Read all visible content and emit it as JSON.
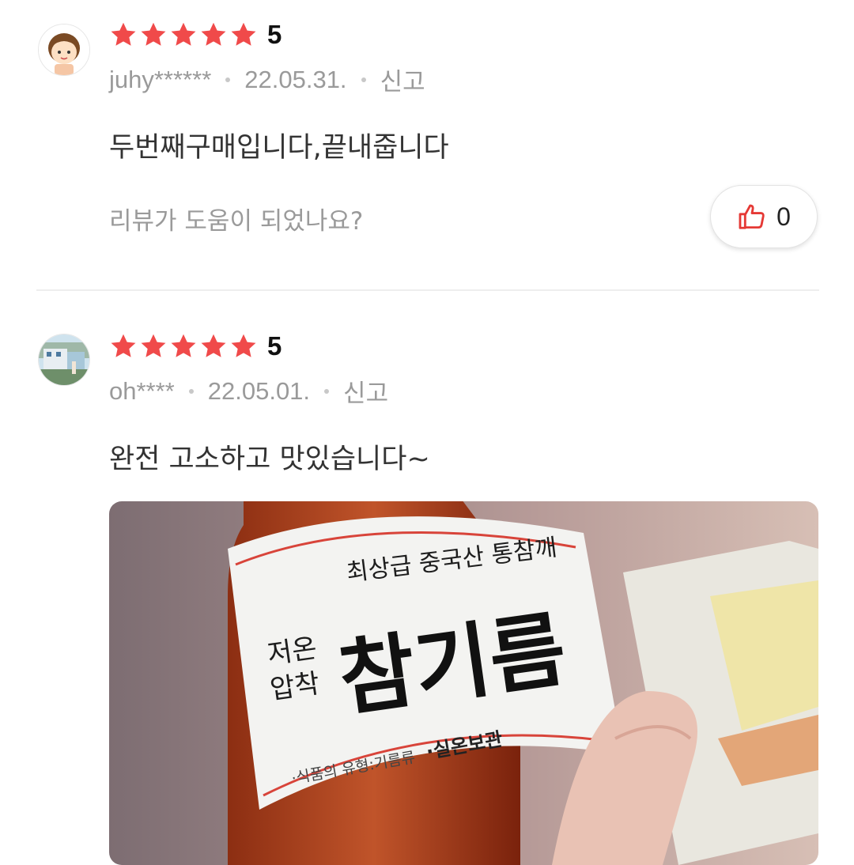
{
  "reviews": [
    {
      "avatar_icon": "cartoon-face-avatar",
      "rating": 5,
      "score": "5",
      "user": "juhy******",
      "date": "22.05.31.",
      "report": "신고",
      "text": "두번째구매입니다,끝내줍니다",
      "helpful_question": "리뷰가 도움이 되었나요?",
      "likes": "0"
    },
    {
      "avatar_icon": "house-photo-avatar",
      "rating": 5,
      "score": "5",
      "user": "oh****",
      "date": "22.05.01.",
      "report": "신고",
      "text": "완전 고소하고 맛있습니다~",
      "photo": {
        "label_top": "최상급 중국산 통참깨",
        "label_side_1": "저온",
        "label_side_2": "압착",
        "label_main": "참기름",
        "label_bottom_1": "·식품의 유형:기름류",
        "label_bottom_2": "·실온보관"
      }
    }
  ],
  "colors": {
    "star": "#f04a4a",
    "like_icon": "#e53935",
    "meta": "#9a9a9a"
  }
}
